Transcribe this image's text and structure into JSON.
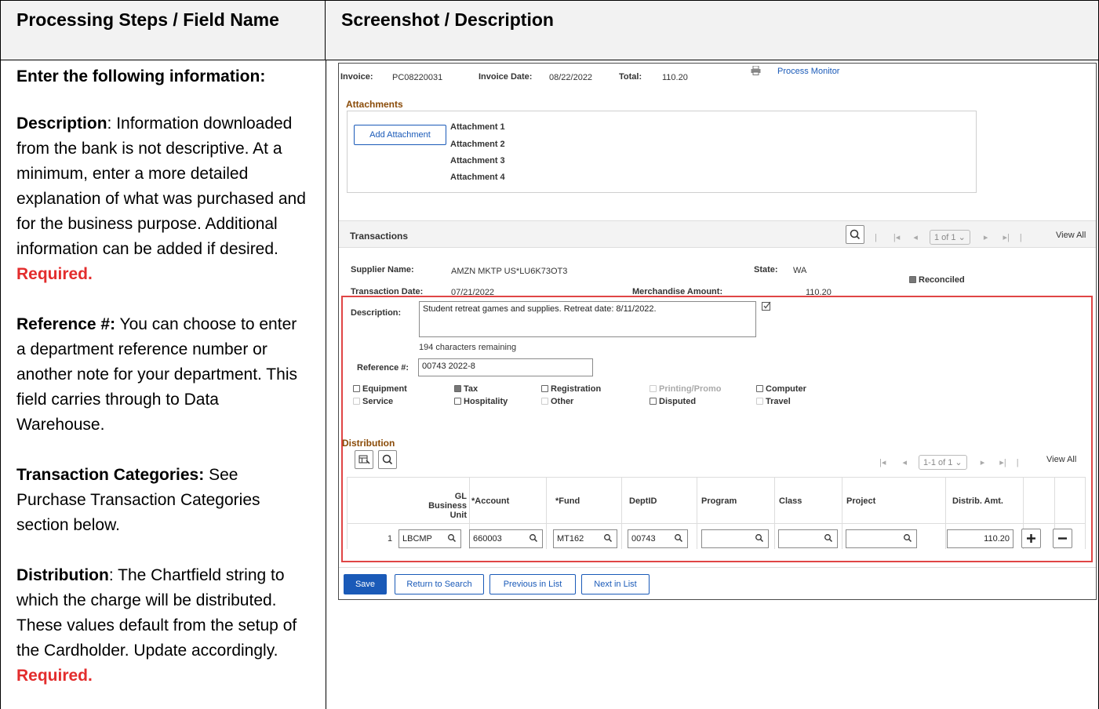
{
  "doc": {
    "col1_header": "Processing Steps / Field Name",
    "col2_header": "Screenshot / Description",
    "intro": "Enter the following information:",
    "p1_label": "Description",
    "p1_text": ": Information downloaded from the bank is not descriptive. At a minimum, enter a more detailed explanation of what was purchased and for the business purpose.  Additional information can be added if desired.  ",
    "required": "Required.",
    "p2_label": "Reference #:",
    "p2_text": " You can choose to enter a department reference number or another note for your department. This field carries through to Data Warehouse.",
    "p3_label": "Transaction Categories:",
    "p3_text": " See Purchase Transaction Categories section below.",
    "p4_label": "Distribution",
    "p4_text": ":  The Chartfield string to which the charge will be distributed.  These values default from the setup of the Cardholder.  Update accordingly. "
  },
  "invoice": {
    "invoice_label": "Invoice:",
    "invoice_value": "PC08220031",
    "date_label": "Invoice Date:",
    "date_value": "08/22/2022",
    "total_label": "Total:",
    "total_value": "110.20",
    "process_monitor": "Process Monitor"
  },
  "attachments": {
    "title": "Attachments",
    "add_button": "Add Attachment",
    "items": [
      "Attachment 1",
      "Attachment 2",
      "Attachment 3",
      "Attachment 4"
    ]
  },
  "transactions": {
    "title": "Transactions",
    "pager_text": "1 of 1",
    "view_all": "View All",
    "supplier_label": "Supplier Name:",
    "supplier_value": "AMZN MKTP US*LU6K73OT3",
    "state_label": "State:",
    "state_value": "WA",
    "reconciled_label": "Reconciled",
    "txn_date_label": "Transaction Date:",
    "txn_date_value": "07/21/2022",
    "merch_label": "Merchandise Amount:",
    "merch_value": "110.20"
  },
  "detail": {
    "description_label": "Description:",
    "description_value": "Student retreat games and supplies. Retreat date: 8/11/2022.",
    "chars_remaining": "194 characters remaining",
    "reference_label": "Reference #:",
    "reference_value": "00743 2022-8"
  },
  "categories": [
    {
      "label": "Equipment",
      "checked": false,
      "disabled": false
    },
    {
      "label": "Tax",
      "checked": true,
      "disabled": false
    },
    {
      "label": "Registration",
      "checked": false,
      "disabled": false
    },
    {
      "label": "Printing/Promo",
      "checked": false,
      "disabled": true
    },
    {
      "label": "Computer",
      "checked": false,
      "disabled": false
    },
    {
      "label": "Service",
      "checked": false,
      "disabled": true
    },
    {
      "label": "Hospitality",
      "checked": false,
      "disabled": false
    },
    {
      "label": "Other",
      "checked": false,
      "disabled": true
    },
    {
      "label": "Disputed",
      "checked": false,
      "disabled": false
    },
    {
      "label": "Travel",
      "checked": false,
      "disabled": true
    }
  ],
  "distribution": {
    "title": "Distribution",
    "pager_text": "1-1 of 1",
    "view_all": "View All",
    "columns": [
      "GL Business Unit",
      "*Account",
      "*Fund",
      "DeptID",
      "Program",
      "Class",
      "Project",
      "Distrib. Amt."
    ],
    "row": {
      "num": "1",
      "gl_business_unit": "LBCMP",
      "account": "660003",
      "fund": "MT162",
      "deptid": "00743",
      "program": "",
      "class": "",
      "project": "",
      "amount": "110.20"
    }
  },
  "buttons": {
    "save": "Save",
    "return": "Return to Search",
    "previous": "Previous in List",
    "next": "Next in List"
  }
}
